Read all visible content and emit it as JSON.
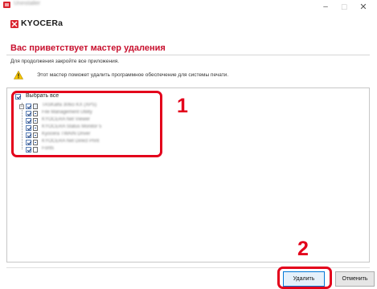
{
  "window": {
    "title": "Uninstaller",
    "min_glyph": "–",
    "max_glyph": "☐",
    "close_glyph": "✕"
  },
  "brand": {
    "logo_text": "KYOCERa",
    "accent_color": "#c8102e"
  },
  "page": {
    "heading": "Вас приветствует мастер удаления",
    "instruction": "Для продолжения закройте все приложения.",
    "info": "Этот мастер поможет удалить программное обеспечение для системы печати."
  },
  "list": {
    "select_all_label": "Выбрать все",
    "expander_glyph": "−",
    "items": [
      {
        "label": "TASKalfa 306ci KX (XPS)",
        "icon": "printer-icon"
      },
      {
        "label": "File Management Utility",
        "icon": "document-icon"
      },
      {
        "label": "KYOCERA Net Viewer",
        "icon": "document-icon"
      },
      {
        "label": "KYOCERA Status Monitor 5",
        "icon": "document-icon"
      },
      {
        "label": "Kyocera TWAIN Driver",
        "icon": "document-icon"
      },
      {
        "label": "KYOCERA Net Direct Print",
        "icon": "document-icon"
      },
      {
        "label": "Fonts",
        "icon": "font-icon"
      }
    ]
  },
  "callouts": {
    "one": "1",
    "two": "2",
    "color": "#e3001b"
  },
  "buttons": {
    "delete_label": "Удалить",
    "cancel_label": "Отменить"
  }
}
